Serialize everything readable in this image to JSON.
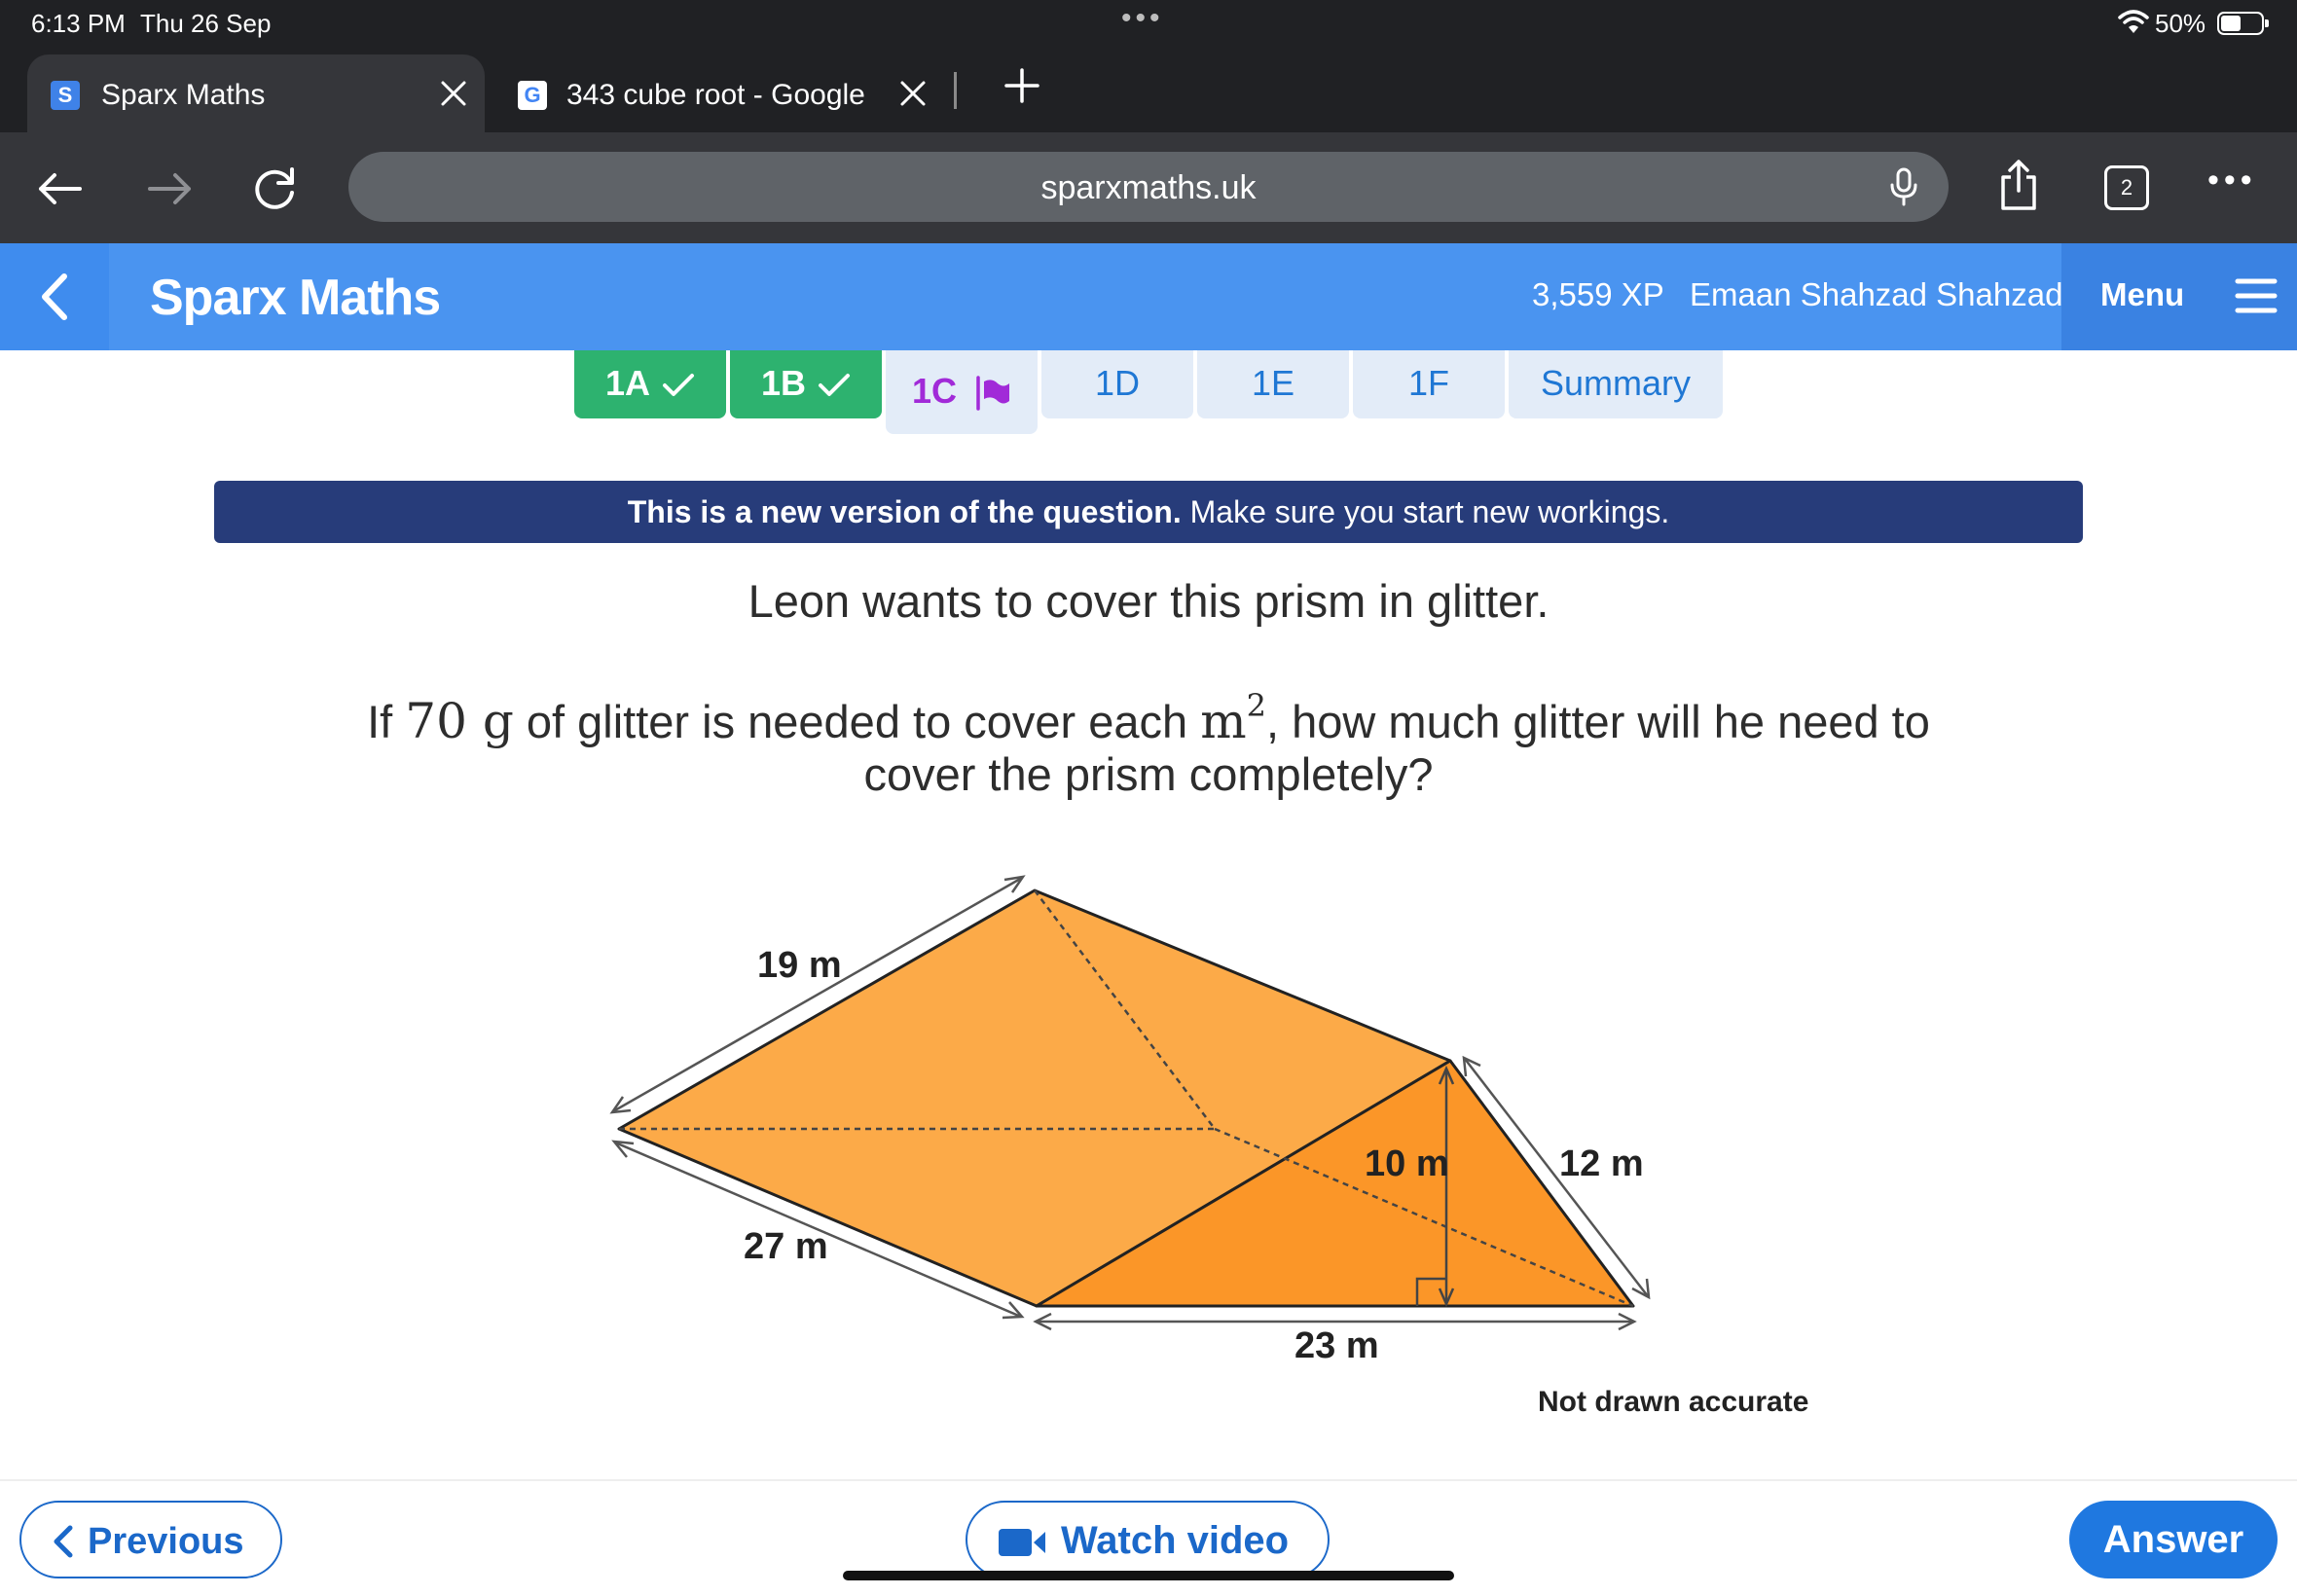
{
  "status_bar": {
    "time": "6:13 PM",
    "date": "Thu 26 Sep",
    "battery_text": "50%",
    "battery_level": 0.5
  },
  "browser": {
    "tabs": [
      {
        "title": "Sparx Maths",
        "favicon": "S",
        "active": true
      },
      {
        "title": "343 cube root - Google",
        "favicon": "G",
        "active": false
      }
    ],
    "url": "sparxmaths.uk",
    "tab_count": "2",
    "accent": "#4285f4"
  },
  "header": {
    "brand": "Sparx Maths",
    "xp": "3,559 XP",
    "user": "Emaan Shahzad Shahzad",
    "menu_label": "Menu",
    "color": "#4a94f0"
  },
  "task_tabs": [
    {
      "label": "1A",
      "status": "done"
    },
    {
      "label": "1B",
      "status": "done"
    },
    {
      "label": "1C",
      "status": "current"
    },
    {
      "label": "1D",
      "status": "todo"
    },
    {
      "label": "1E",
      "status": "todo"
    },
    {
      "label": "1F",
      "status": "todo"
    },
    {
      "label": "Summary",
      "status": "todo"
    }
  ],
  "notice": {
    "bold": "This is a new version of the question.",
    "text": " Make sure you start new workings."
  },
  "question": {
    "line1": "Leon wants to cover this prism in glitter.",
    "line2_prefix": "If ",
    "mass_value": "70",
    "mass_unit": " g",
    "line2_mid": " of glitter is needed to cover each ",
    "area_unit": "m",
    "area_exp": "2",
    "line2_suffix": ", how much glitter will he need to",
    "line3": "cover the prism completely?"
  },
  "diagram": {
    "labels": {
      "top_edge": "19 m",
      "left_edge": "27 m",
      "height": "10 m",
      "slant": "12 m",
      "base": "23 m"
    },
    "note": "Not drawn accurately",
    "colors": {
      "face": "#fcaa48",
      "end_face": "#fb9628"
    }
  },
  "buttons": {
    "previous": "Previous",
    "watch_video": "Watch video",
    "answer": "Answer"
  }
}
